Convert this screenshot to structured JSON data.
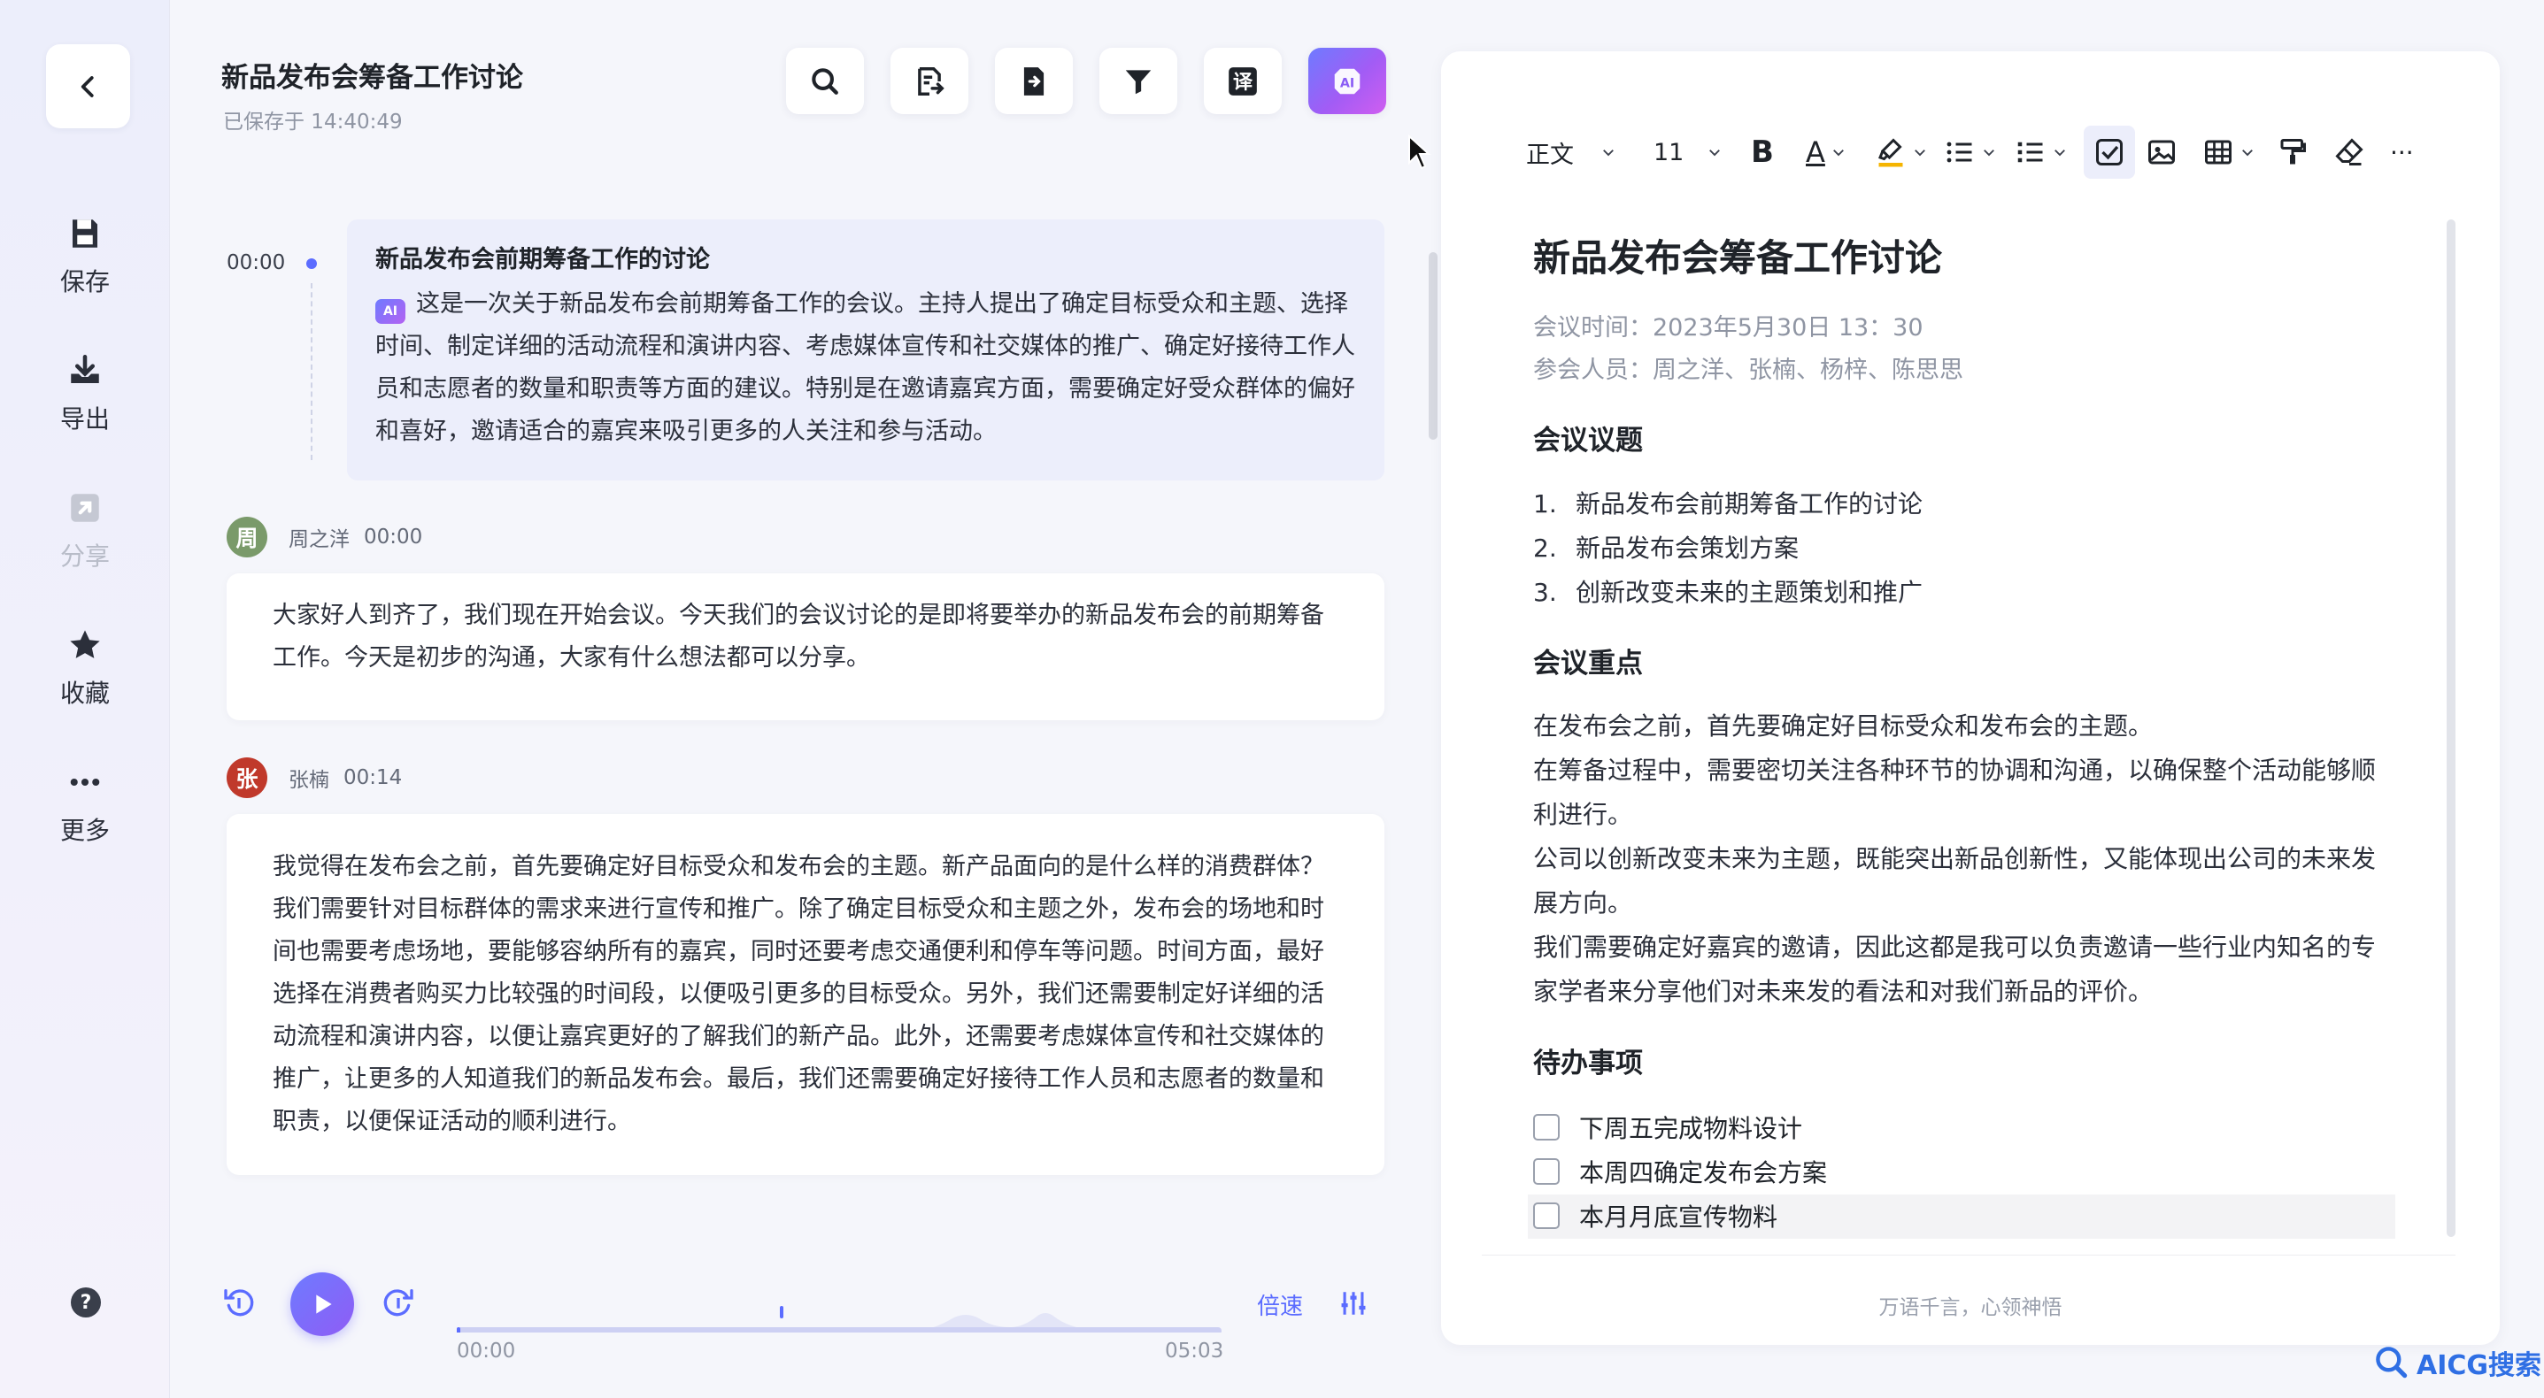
{
  "header": {
    "title": "新品发布会筹备工作讨论",
    "saved": "已保存于 14:40:49",
    "tools": [
      {
        "icon": "search-icon"
      },
      {
        "icon": "document-list-icon"
      },
      {
        "icon": "export-file-icon"
      },
      {
        "icon": "filter-icon"
      },
      {
        "icon": "translate-icon",
        "glyph": "译"
      },
      {
        "icon": "ai-assistant-icon",
        "glyph": "AI"
      }
    ]
  },
  "sidebar": {
    "items": [
      {
        "label": "保存",
        "icon": "save-icon"
      },
      {
        "label": "导出",
        "icon": "download-icon"
      },
      {
        "label": "分享",
        "icon": "share-icon",
        "disabled": true
      },
      {
        "label": "收藏",
        "icon": "star-icon"
      },
      {
        "label": "更多",
        "icon": "more-icon"
      }
    ],
    "help_glyph": "?"
  },
  "summary": {
    "time": "00:00",
    "title": "新品发布会前期筹备工作的讨论",
    "ai_glyph": "AI",
    "body": "这是一次关于新品发布会前期筹备工作的会议。主持人提出了确定目标受众和主题、选择时间、制定详细的活动流程和演讲内容、考虑媒体宣传和社交媒体的推广、确定好接待工作人员和志愿者的数量和职责等方面的建议。特别是在邀请嘉宾方面，需要确定好受众群体的偏好和喜好，邀请适合的嘉宾来吸引更多的人关注和参与活动。"
  },
  "transcript": [
    {
      "avatar": "周",
      "avatar_color": "#7a9a6a",
      "name": "周之洋",
      "time": "00:00",
      "text": "大家好人到齐了，我们现在开始会议。今天我们的会议讨论的是即将要举办的新品发布会的前期筹备工作。今天是初步的沟通，大家有什么想法都可以分享。"
    },
    {
      "avatar": "张",
      "avatar_color": "#c0392b",
      "name": "张楠",
      "time": "00:14",
      "text": "我觉得在发布会之前，首先要确定好目标受众和发布会的主题。新产品面向的是什么样的消费群体？我们需要针对目标群体的需求来进行宣传和推广。除了确定目标受众和主题之外，发布会的场地和时间也需要考虑场地，要能够容纳所有的嘉宾，同时还要考虑交通便利和停车等问题。时间方面，最好选择在消费者购买力比较强的时间段，以便吸引更多的目标受众。另外，我们还需要制定好详细的活动流程和演讲内容，以便让嘉宾更好的了解我们的新产品。此外，还需要考虑媒体宣传和社交媒体的推广，让更多的人知道我们的新品发布会。最后，我们还需要确定好接待工作人员和志愿者的数量和职责，以便保证活动的顺利进行。"
    }
  ],
  "player": {
    "current": "00:00",
    "total": "05:03",
    "speed_label": "倍速",
    "progress": 0.0
  },
  "editor": {
    "toolbar": {
      "style": "正文",
      "font_size": "11",
      "bold": "B",
      "font_color_glyph": "A",
      "more_glyph": "···"
    },
    "title": "新品发布会筹备工作讨论",
    "meeting_time": "会议时间：2023年5月30日 13：30",
    "attendees": "参会人员：周之洋、张楠、杨梓、陈思思",
    "topics_heading": "会议议题",
    "topics": [
      {
        "num": "1.",
        "text": "新品发布会前期筹备工作的讨论"
      },
      {
        "num": "2.",
        "text": "新品发布会策划方案"
      },
      {
        "num": "3.",
        "text": "创新改变未来的主题策划和推广"
      }
    ],
    "keypoints_heading": "会议重点",
    "keypoints": [
      "在发布会之前，首先要确定好目标受众和发布会的主题。",
      "在筹备过程中，需要密切关注各种环节的协调和沟通，以确保整个活动能够顺利进行。",
      "公司以创新改变未来为主题，既能突出新品创新性，又能体现出公司的未来发展方向。",
      "我们需要确定好嘉宾的邀请，因此这都是我可以负责邀请一些行业内知名的专家学者来分享他们对未来发的看法和对我们新品的评价。"
    ],
    "todo_heading": "待办事项",
    "todos": [
      {
        "text": "下周五完成物料设计",
        "checked": false
      },
      {
        "text": "本周四确定发布会方案",
        "checked": false
      },
      {
        "text": "本月月底宣传物料",
        "checked": false
      }
    ],
    "slogan": "万语千言，心领神悟"
  },
  "watermark": {
    "text": "AICG搜索"
  }
}
